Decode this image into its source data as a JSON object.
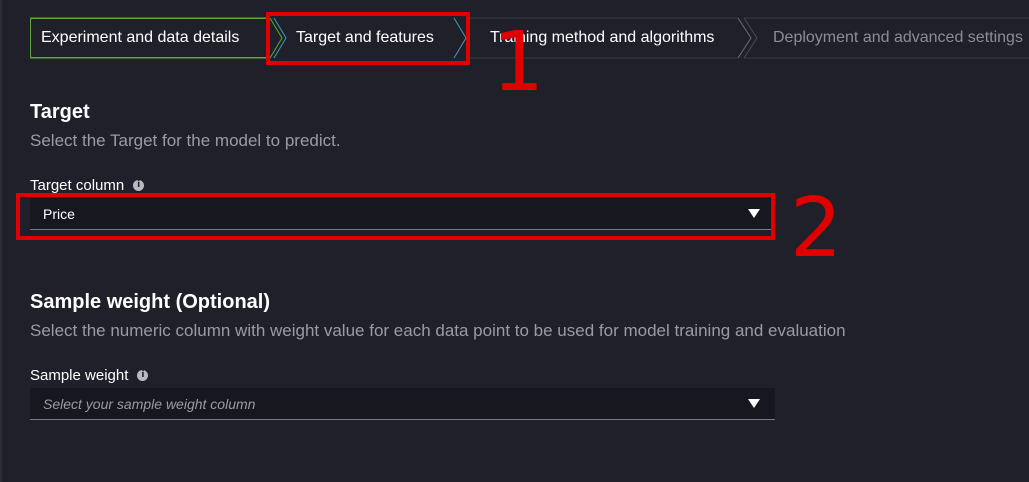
{
  "stepper": {
    "steps": [
      {
        "label": "Experiment and data details",
        "state": "completed"
      },
      {
        "label": "Target and features",
        "state": "current"
      },
      {
        "label": "Training method and algorithms",
        "state": "upcoming"
      },
      {
        "label": "Deployment and advanced settings",
        "state": "disabled"
      }
    ]
  },
  "annotations": {
    "marker_1": "1",
    "marker_2": "2",
    "color": "#e00000"
  },
  "target": {
    "title": "Target",
    "description": "Select the Target for the model to predict.",
    "column_label": "Target column",
    "selected_value": "Price",
    "info_icon": "info-icon"
  },
  "sample_weight": {
    "title": "Sample weight (Optional)",
    "description": "Select the numeric column with weight value for each data point to be used for model training and evaluation",
    "label": "Sample weight",
    "placeholder": "Select your sample weight column",
    "info_icon": "info-icon"
  },
  "colors": {
    "background": "#1f2029",
    "completed_step_border": "#5fa83a",
    "current_step_chevron": "#3aa0b8",
    "muted_text": "#9a9ba3"
  }
}
